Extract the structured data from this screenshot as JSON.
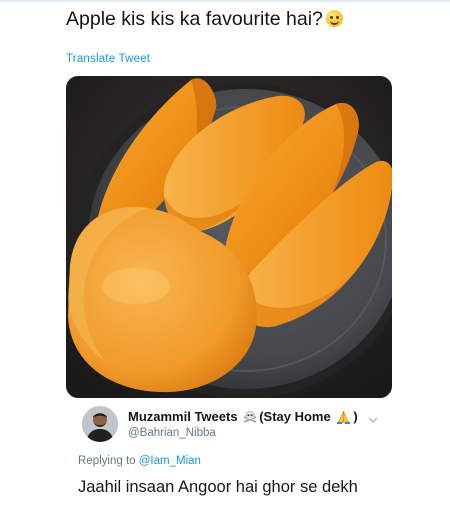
{
  "tweet": {
    "text": "Apple kis kis ka favourite hai?",
    "emoji_icon": "slightly-smiling-face-icon",
    "translate_label": "Translate Tweet"
  },
  "photo": {
    "subject_icon": "mango-slices-photo",
    "colors": {
      "mango": "#f39a1f",
      "plate": "#4a4c50",
      "background": "#2b2a2a"
    }
  },
  "quoted": {
    "author_name": "Muzammil Tweets",
    "author_name_suffix": "(Stay Home",
    "author_name_end": ")",
    "name_icons": [
      "skull-crossbones-icon",
      "folded-hands-icon"
    ],
    "handle": "@Bahrian_Nibba",
    "reply_prefix": "Replying to",
    "reply_to": "@Iam_Mian",
    "text": "Jaahil insaan Angoor hai ghor se dekh"
  },
  "colors": {
    "link": "#1b95e0",
    "muted": "#657786",
    "text": "#14171a"
  }
}
